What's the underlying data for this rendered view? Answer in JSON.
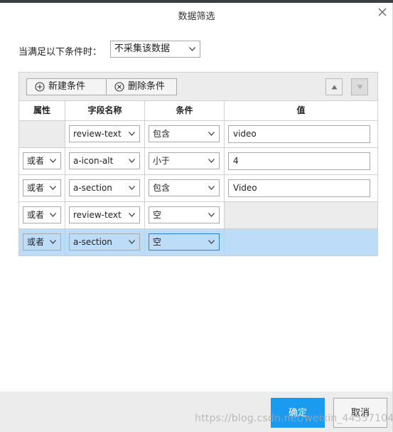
{
  "dialog": {
    "title": "数据筛选",
    "close_icon": "close-icon"
  },
  "condition": {
    "label": "当满足以下条件时：",
    "mode_selected": "不采集该数据"
  },
  "toolbar": {
    "add_label": "新建条件",
    "delete_label": "删除条件",
    "up_icon": "arrow-up-icon",
    "down_icon": "arrow-down-icon"
  },
  "table": {
    "headers": [
      "属性",
      "字段名称",
      "条件",
      "值"
    ],
    "rows": [
      {
        "relation": "",
        "field": "review-text",
        "condition": "包含",
        "value": "video"
      },
      {
        "relation": "或者",
        "field": "a-icon-alt",
        "condition": "小于",
        "value": "4"
      },
      {
        "relation": "或者",
        "field": "a-section",
        "condition": "包含",
        "value": "Video"
      },
      {
        "relation": "或者",
        "field": "review-text",
        "condition": "空",
        "value": ""
      },
      {
        "relation": "或者",
        "field": "a-section",
        "condition": "空",
        "value": ""
      }
    ],
    "selected_row": 4
  },
  "footer": {
    "ok_label": "确定",
    "cancel_label": "取消"
  },
  "watermark": "https://blog.csdn.net/weixin_44557104",
  "colors": {
    "primary": "#1a9bf0",
    "selected_row": "#bcdcf7",
    "toolbar_bg": "#ececec"
  }
}
